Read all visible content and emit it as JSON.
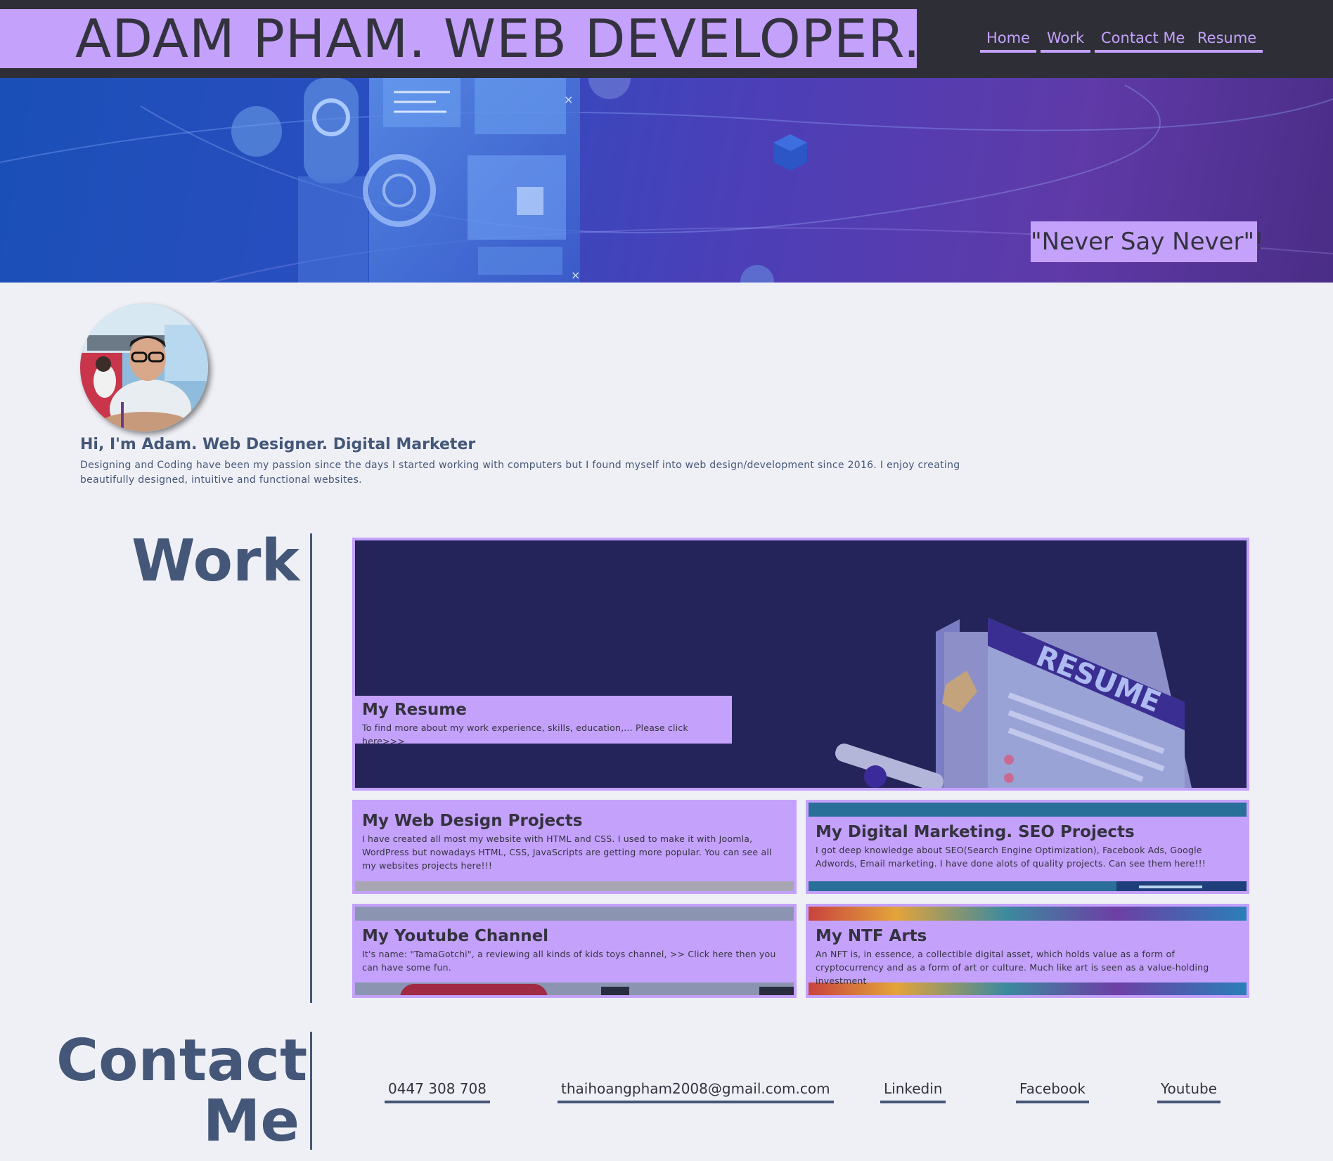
{
  "header": {
    "site_title": "ADAM PHAM. WEB DEVELOPER.",
    "nav": [
      {
        "label": "Home"
      },
      {
        "label": "Work"
      },
      {
        "label": "Contact Me"
      },
      {
        "label": "Resume"
      }
    ]
  },
  "hero": {
    "quote": "\"Never Say Never\"!"
  },
  "about": {
    "heading": "Hi, I'm Adam. Web Designer. Digital Marketer",
    "text": "Designing and Coding have been my passion since the days I started working with computers but I found myself into web design/development since 2016. I enjoy creating beautifully designed, intuitive and functional websites."
  },
  "work": {
    "heading": "Work",
    "cards": [
      {
        "title": "My Resume",
        "desc": "To find more about my work experience, skills, education,... Please click here>>>",
        "image_label": "RESUME"
      },
      {
        "title": "My Web Design Projects",
        "desc": "I have created all most my website with HTML and CSS. I used to make it with Joomla, WordPress but nowadays HTML, CSS, JavaScripts are getting more popular. You can see all my websites projects here!!!"
      },
      {
        "title": "My Digital Marketing. SEO Projects",
        "desc": "I got deep knowledge about SEO(Search Engine Optimization), Facebook Ads, Google Adwords, Email marketing. I have done alots of quality projects. Can see them here!!!"
      },
      {
        "title": "My Youtube Channel",
        "desc": "It's name: \"TamaGotchi\", a reviewing all kinds of kids toys channel, >> Click here then you can have some fun."
      },
      {
        "title": "My NTF Arts",
        "desc": "An NFT is, in essence, a collectible digital asset, which holds value as a form of cryptocurrency and as a form of art or culture. Much like art is seen as a value-holding investment"
      }
    ]
  },
  "contact": {
    "heading_line1": "Contact",
    "heading_line2": "Me",
    "links": [
      {
        "label": "0447 308 708"
      },
      {
        "label": "thaihoangpham2008@gmail.com.com"
      },
      {
        "label": "Linkedin"
      },
      {
        "label": "Facebook"
      },
      {
        "label": "Youtube"
      }
    ]
  },
  "colors": {
    "accent": "#c4a1fb",
    "header_bg": "#2e2f36",
    "page_bg": "#eff0f6",
    "heading_text": "#445778",
    "dark_text": "#33333f"
  }
}
